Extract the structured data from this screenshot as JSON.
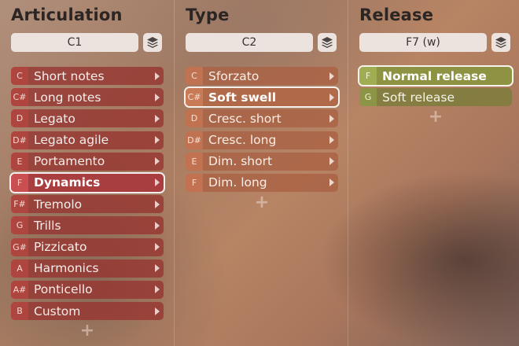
{
  "articulation": {
    "title": "Articulation",
    "key": "C1",
    "items": [
      {
        "note": "C",
        "label": "Short notes",
        "selected": false
      },
      {
        "note": "C#",
        "label": "Long notes",
        "selected": false
      },
      {
        "note": "D",
        "label": "Legato",
        "selected": false
      },
      {
        "note": "D#",
        "label": "Legato agile",
        "selected": false
      },
      {
        "note": "E",
        "label": "Portamento",
        "selected": false
      },
      {
        "note": "F",
        "label": "Dynamics",
        "selected": true
      },
      {
        "note": "F#",
        "label": "Tremolo",
        "selected": false
      },
      {
        "note": "G",
        "label": "Trills",
        "selected": false
      },
      {
        "note": "G#",
        "label": "Pizzicato",
        "selected": false
      },
      {
        "note": "A",
        "label": "Harmonics",
        "selected": false
      },
      {
        "note": "A#",
        "label": "Ponticello",
        "selected": false
      },
      {
        "note": "B",
        "label": "Custom",
        "selected": false
      }
    ],
    "add": "+"
  },
  "type": {
    "title": "Type",
    "key": "C2",
    "items": [
      {
        "note": "C",
        "label": "Sforzato",
        "selected": false
      },
      {
        "note": "C#",
        "label": "Soft swell",
        "selected": true
      },
      {
        "note": "D",
        "label": "Cresc. short",
        "selected": false
      },
      {
        "note": "D#",
        "label": "Cresc. long",
        "selected": false
      },
      {
        "note": "E",
        "label": "Dim. short",
        "selected": false
      },
      {
        "note": "F",
        "label": "Dim. long",
        "selected": false
      }
    ],
    "add": "+"
  },
  "release": {
    "title": "Release",
    "key": "F7 (w)",
    "items": [
      {
        "note": "F",
        "label": "Normal release",
        "selected": true
      },
      {
        "note": "G",
        "label": "Soft release",
        "selected": false
      }
    ],
    "add": "+"
  },
  "icons": {
    "stack": "layers-icon",
    "arrow": "chevron-right-icon",
    "add": "plus-icon"
  }
}
